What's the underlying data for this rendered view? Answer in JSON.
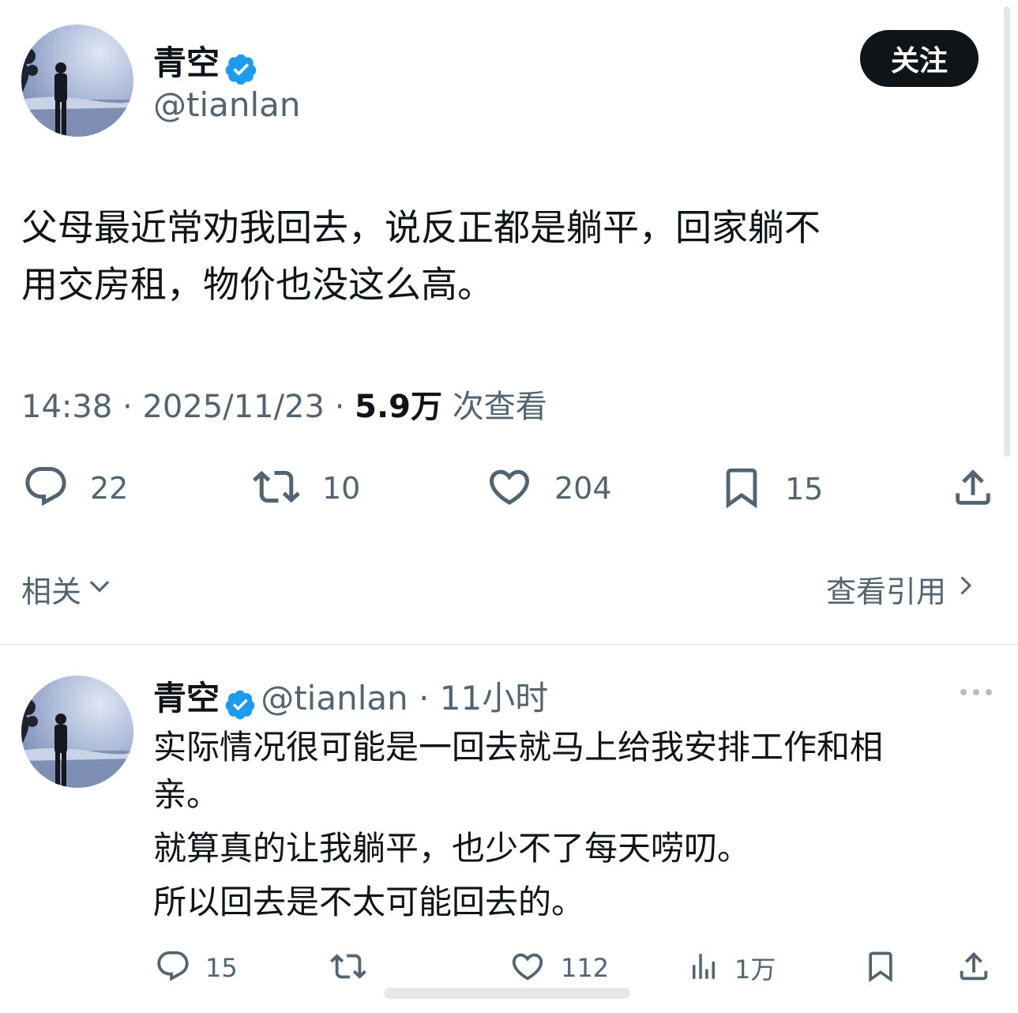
{
  "main_tweet": {
    "author_name": "青空",
    "handle": "@tianlan",
    "follow_label": "关注",
    "text_line1": "父母最近常劝我回去，说反正都是躺平，回家躺不",
    "text_line2": "用交房租，物价也没这么高。",
    "time": "14:38",
    "date": "2025/11/23",
    "views_count": "5.9万",
    "views_label": "次查看",
    "actions": {
      "replies": "22",
      "retweets": "10",
      "likes": "204",
      "bookmarks": "15"
    }
  },
  "related": {
    "label": "相关",
    "quotes_link": "查看引用"
  },
  "reply_tweet": {
    "author_name": "青空",
    "handle": "@tianlan",
    "time_ago": "11小时",
    "text_line1": "实际情况很可能是一回去就马上给我安排工作和相",
    "text_line2": "亲。",
    "text_line3": "就算真的让我躺平，也少不了每天唠叨。",
    "text_line4": "所以回去是不太可能回去的。",
    "actions": {
      "replies": "15",
      "likes": "112",
      "views": "1万"
    }
  },
  "colors": {
    "verified": "#1d9bf0",
    "text": "#0f1419",
    "secondary": "#536471"
  },
  "icons": [
    "verified-badge-icon",
    "reply-icon",
    "retweet-icon",
    "like-icon",
    "bookmark-icon",
    "share-icon",
    "chevron-down-icon",
    "chevron-right-icon",
    "more-icon",
    "views-icon"
  ]
}
